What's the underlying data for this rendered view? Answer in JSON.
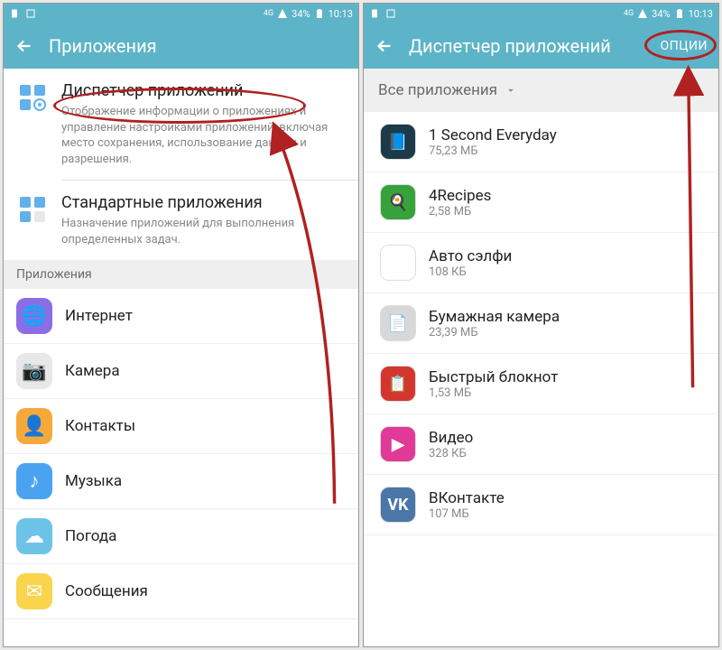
{
  "status": {
    "network": "4G",
    "battery": "34%",
    "time": "10:13"
  },
  "left": {
    "appbar": {
      "title": "Приложения"
    },
    "blocks": [
      {
        "title": "Диспетчер приложений",
        "desc": "Отображение информации о приложениях и управление настройками приложений, включая место сохранения, использование данных и разрешения."
      },
      {
        "title": "Стандартные приложения",
        "desc": "Назначение приложений для выполнения определенных задач."
      }
    ],
    "section": "Приложения",
    "apps": [
      {
        "name": "Интернет",
        "color": "#8b6ee6"
      },
      {
        "name": "Камера",
        "color": "#e8e8e8"
      },
      {
        "name": "Контакты",
        "color": "#f6a93b"
      },
      {
        "name": "Музыка",
        "color": "#4aa3f0"
      },
      {
        "name": "Погода",
        "color": "#6ec4e8"
      },
      {
        "name": "Сообщения",
        "color": "#f9d44c"
      }
    ]
  },
  "right": {
    "appbar": {
      "title": "Диспетчер приложений",
      "options": "ОПЦИИ"
    },
    "filter": "Все приложения",
    "apps": [
      {
        "name": "1 Second Everyday",
        "size": "75,23 МБ",
        "color": "#1b3a4a"
      },
      {
        "name": "4Recipes",
        "size": "2,58 МБ",
        "color": "#37a23b"
      },
      {
        "name": "Авто сэлфи",
        "size": "108 КБ",
        "color": "#ffffff"
      },
      {
        "name": "Бумажная камера",
        "size": "23,39 МБ",
        "color": "#d8d8d8"
      },
      {
        "name": "Быстрый блокнот",
        "size": "1,53 МБ",
        "color": "#d3362e"
      },
      {
        "name": "Видео",
        "size": "328 КБ",
        "color": "#e03997"
      },
      {
        "name": "ВКонтакте",
        "size": "107 МБ",
        "color": "#4a76a8"
      }
    ]
  }
}
